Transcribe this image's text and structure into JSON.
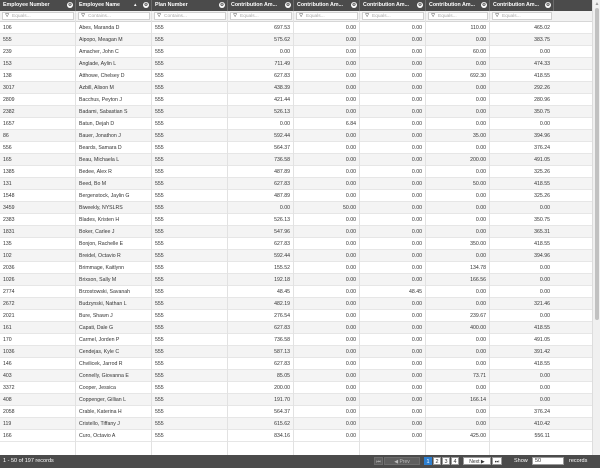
{
  "columns": [
    {
      "label": "Employee Number",
      "filter": "Equals..."
    },
    {
      "label": "Employee Name",
      "filter": "Contains..."
    },
    {
      "label": "Plan Number",
      "filter": "Contains..."
    },
    {
      "label": "Contribution Am...",
      "filter": "Equals..."
    },
    {
      "label": "Contribution Am...",
      "filter": "Equals..."
    },
    {
      "label": "Contribution Am...",
      "filter": "Equals..."
    },
    {
      "label": "Contribution Am...",
      "filter": "Equals..."
    },
    {
      "label": "Contribution Am...",
      "filter": "Equals..."
    }
  ],
  "rows": [
    [
      "106",
      "Abes, Maranda D",
      "555",
      "697.53",
      "0.00",
      "0.00",
      "110.00",
      "465.02"
    ],
    [
      "555",
      "Aipopo, Meagan M",
      "555",
      "575.62",
      "0.00",
      "0.00",
      "0.00",
      "383.75"
    ],
    [
      "239",
      "Amacher, John C",
      "555",
      "0.00",
      "0.00",
      "0.00",
      "60.00",
      "0.00"
    ],
    [
      "153",
      "Anglade, Aylin L",
      "555",
      "711.49",
      "0.00",
      "0.00",
      "0.00",
      "474.33"
    ],
    [
      "138",
      "Atthowe, Chelsey D",
      "555",
      "627.83",
      "0.00",
      "0.00",
      "692.30",
      "418.55"
    ],
    [
      "3017",
      "Azbill, Alison M",
      "555",
      "438.39",
      "0.00",
      "0.00",
      "0.00",
      "292.26"
    ],
    [
      "2809",
      "Bacchus, Peyton J",
      "555",
      "421.44",
      "0.00",
      "0.00",
      "0.00",
      "280.96"
    ],
    [
      "2382",
      "Badami, Sabastian S",
      "555",
      "526.13",
      "0.00",
      "0.00",
      "0.00",
      "350.75"
    ],
    [
      "1657",
      "Batun, Dejah D",
      "555",
      "0.00",
      "6.84",
      "0.00",
      "0.00",
      "0.00"
    ],
    [
      "86",
      "Bauer, Jonathon J",
      "555",
      "592.44",
      "0.00",
      "0.00",
      "35.00",
      "394.96"
    ],
    [
      "556",
      "Beards, Samara D",
      "555",
      "564.37",
      "0.00",
      "0.00",
      "0.00",
      "376.24"
    ],
    [
      "165",
      "Beau, Michaela L",
      "555",
      "736.58",
      "0.00",
      "0.00",
      "200.00",
      "491.05"
    ],
    [
      "1385",
      "Bedee, Alex R",
      "555",
      "487.89",
      "0.00",
      "0.00",
      "0.00",
      "325.26"
    ],
    [
      "131",
      "Beed, Bo M",
      "555",
      "627.83",
      "0.00",
      "0.00",
      "50.00",
      "418.55"
    ],
    [
      "1548",
      "Bergenstock, Jaylin G",
      "555",
      "487.89",
      "0.00",
      "0.00",
      "0.00",
      "325.26"
    ],
    [
      "3459",
      "Biweekly, NYSLRS",
      "555",
      "0.00",
      "50.00",
      "0.00",
      "0.00",
      "0.00"
    ],
    [
      "2383",
      "Blades, Kristen H",
      "555",
      "526.13",
      "0.00",
      "0.00",
      "0.00",
      "350.75"
    ],
    [
      "1831",
      "Boker, Carlee J",
      "555",
      "547.96",
      "0.00",
      "0.00",
      "0.00",
      "365.31"
    ],
    [
      "135",
      "Bonjon, Rachelle E",
      "555",
      "627.83",
      "0.00",
      "0.00",
      "350.00",
      "418.55"
    ],
    [
      "102",
      "Breidel, Octavio R",
      "555",
      "592.44",
      "0.00",
      "0.00",
      "0.00",
      "394.96"
    ],
    [
      "2036",
      "Brimmage, Kaitlynn",
      "555",
      "155.52",
      "0.00",
      "0.00",
      "134.78",
      "0.00"
    ],
    [
      "1026",
      "Brixson, Sally M",
      "555",
      "192.18",
      "0.00",
      "0.00",
      "166.56",
      "0.00"
    ],
    [
      "2774",
      "Brzostowski, Savanah",
      "555",
      "48.45",
      "0.00",
      "48.45",
      "0.00",
      "0.00"
    ],
    [
      "2672",
      "Budzynski, Nathan L",
      "555",
      "482.19",
      "0.00",
      "0.00",
      "0.00",
      "321.46"
    ],
    [
      "2021",
      "Bure, Shawn J",
      "555",
      "276.54",
      "0.00",
      "0.00",
      "239.67",
      "0.00"
    ],
    [
      "161",
      "Capati, Dale G",
      "555",
      "627.83",
      "0.00",
      "0.00",
      "400.00",
      "418.55"
    ],
    [
      "170",
      "Carmel, Jorden P",
      "555",
      "736.58",
      "0.00",
      "0.00",
      "0.00",
      "491.05"
    ],
    [
      "1036",
      "Cendejas, Kyle C",
      "555",
      "587.13",
      "0.00",
      "0.00",
      "0.00",
      "391.42"
    ],
    [
      "146",
      "Chvilicek, Jarrod R",
      "555",
      "627.83",
      "0.00",
      "0.00",
      "0.00",
      "418.55"
    ],
    [
      "403",
      "Connelly, Giovanna E",
      "555",
      "85.05",
      "0.00",
      "0.00",
      "73.71",
      "0.00"
    ],
    [
      "3372",
      "Cooper, Jessica",
      "555",
      "200.00",
      "0.00",
      "0.00",
      "0.00",
      "0.00"
    ],
    [
      "408",
      "Coppenger, Gillian L",
      "555",
      "191.70",
      "0.00",
      "0.00",
      "166.14",
      "0.00"
    ],
    [
      "2058",
      "Crable, Katerina H",
      "555",
      "564.37",
      "0.00",
      "0.00",
      "0.00",
      "376.24"
    ],
    [
      "119",
      "Cristello, Tiffany J",
      "555",
      "615.62",
      "0.00",
      "0.00",
      "0.00",
      "410.42"
    ],
    [
      "166",
      "Curo, Octavio A",
      "555",
      "834.16",
      "0.00",
      "0.00",
      "425.00",
      "556.11"
    ]
  ],
  "footer": {
    "records": "1 - 50 of 197 records",
    "prev": "Prev",
    "pages": [
      "1",
      "2",
      "3",
      "4"
    ],
    "next": "Next",
    "show_label": "Show",
    "show_value": "50",
    "records_label": "records"
  }
}
